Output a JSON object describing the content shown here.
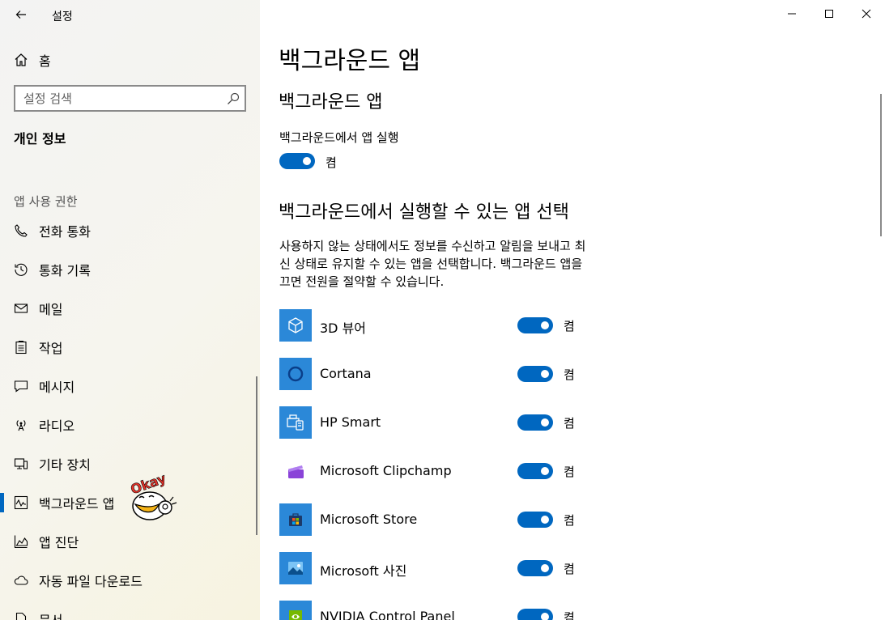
{
  "window": {
    "title": "설정"
  },
  "sidebar": {
    "home_label": "홈",
    "search_placeholder": "설정 검색",
    "section_title": "개인 정보",
    "group_title": "앱 사용 권한",
    "items": [
      {
        "label": "전화 통화",
        "icon": "phone-icon"
      },
      {
        "label": "통화 기록",
        "icon": "history-icon"
      },
      {
        "label": "메일",
        "icon": "mail-icon"
      },
      {
        "label": "작업",
        "icon": "clipboard-icon"
      },
      {
        "label": "메시지",
        "icon": "message-icon"
      },
      {
        "label": "라디오",
        "icon": "radio-icon"
      },
      {
        "label": "기타 장치",
        "icon": "device-icon"
      },
      {
        "label": "백그라운드 앱",
        "icon": "activity-icon",
        "selected": true
      },
      {
        "label": "앱 진단",
        "icon": "chart-icon"
      },
      {
        "label": "자동 파일 다운로드",
        "icon": "cloud-icon"
      },
      {
        "label": "문서",
        "icon": "document-icon"
      }
    ]
  },
  "main": {
    "page_title": "백그라운드 앱",
    "sub_title": "백그라운드 앱",
    "run_label": "백그라운드에서 앱 실행",
    "run_state": "켬",
    "choose_title": "백그라운드에서 실행할 수 있는 앱 선택",
    "description_lines": [
      "사용하지 않는 상태에서도 정보를 수신하고 알림을 보내고 최",
      "신 상태로 유지할 수 있는 앱을 선택합니다. 백그라운드 앱을",
      "끄면 전원을 절약할 수 있습니다."
    ],
    "apps": [
      {
        "name": "3D 뷰어",
        "state": "켬",
        "icon": "cube-icon",
        "color": "#2b88d8"
      },
      {
        "name": "Cortana",
        "state": "켬",
        "icon": "cortana-ring-icon",
        "color": "#2b88d8"
      },
      {
        "name": "HP Smart",
        "state": "켬",
        "icon": "printer-icon",
        "color": "#2b88d8"
      },
      {
        "name": "Microsoft Clipchamp",
        "state": "켬",
        "icon": "clapperboard-icon",
        "color": "#ffffff"
      },
      {
        "name": "Microsoft Store",
        "state": "켬",
        "icon": "store-bag-icon",
        "color": "#2b88d8"
      },
      {
        "name": "Microsoft 사진",
        "state": "켬",
        "icon": "photo-icon",
        "color": "#2b88d8"
      },
      {
        "name": "NVIDIA Control Panel",
        "state": "켬",
        "icon": "nvidia-icon",
        "color": "#2b88d8"
      }
    ]
  },
  "colors": {
    "accent": "#0067c0",
    "tile": "#2b88d8"
  }
}
